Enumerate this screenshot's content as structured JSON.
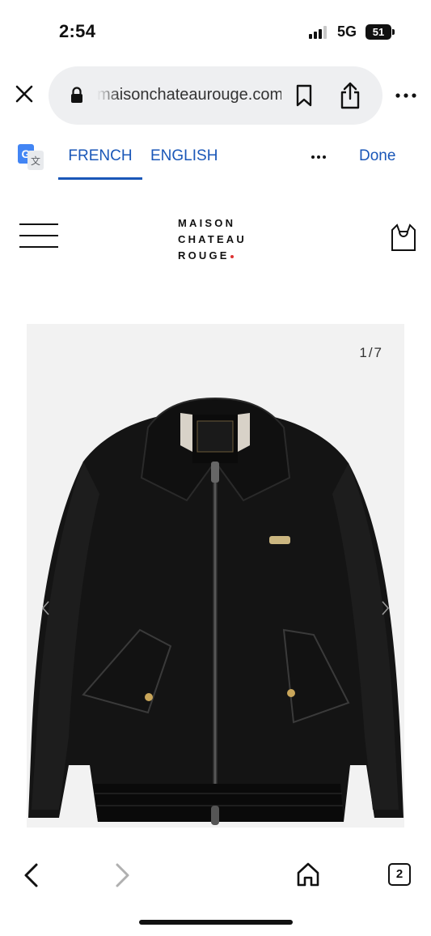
{
  "status_bar": {
    "time": "2:54",
    "network": "5G",
    "battery": "51"
  },
  "browser": {
    "url": "maisonchateaurouge.com",
    "icons": {
      "close": "close-icon",
      "lock": "lock-icon",
      "bookmark": "bookmark-icon",
      "share": "share-icon",
      "more": "more-icon"
    }
  },
  "translate": {
    "tabs": [
      {
        "label": "FRENCH",
        "selected": true
      },
      {
        "label": "ENGLISH",
        "selected": false
      }
    ],
    "done_label": "Done",
    "accent_color": "#1a57b8"
  },
  "site": {
    "logo_lines": [
      "MAISON",
      "CHATEAU",
      "ROUGE"
    ],
    "icons": {
      "menu": "hamburger-icon",
      "bag": "shopping-bag-icon"
    }
  },
  "gallery": {
    "counter": "1/7",
    "image": "black leather bomber jacket"
  },
  "bottom_nav": {
    "tab_count": "2"
  }
}
